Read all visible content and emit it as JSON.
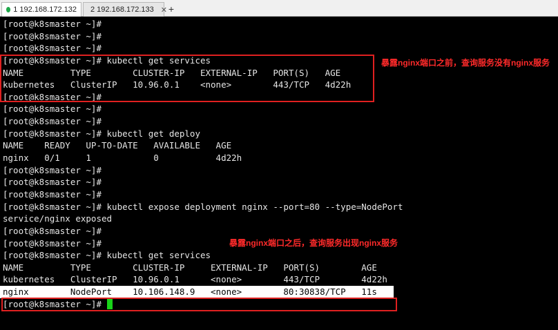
{
  "tabs": [
    {
      "label": "1 192.168.172.132",
      "active": true,
      "dot_color": "#1fa84a"
    },
    {
      "label": "2 192.168.172.133",
      "active": false,
      "dot_color": "#1fa84a"
    }
  ],
  "tab_add_label": "+",
  "terminal": {
    "lines": [
      "[root@k8smaster ~]#",
      "[root@k8smaster ~]#",
      "[root@k8smaster ~]#",
      "[root@k8smaster ~]# kubectl get services",
      "NAME         TYPE        CLUSTER-IP   EXTERNAL-IP   PORT(S)   AGE",
      "kubernetes   ClusterIP   10.96.0.1    <none>        443/TCP   4d22h",
      "[root@k8smaster ~]#",
      "[root@k8smaster ~]#",
      "[root@k8smaster ~]#",
      "[root@k8smaster ~]# kubectl get deploy",
      "NAME    READY   UP-TO-DATE   AVAILABLE   AGE",
      "nginx   0/1     1            0           4d22h",
      "[root@k8smaster ~]#",
      "[root@k8smaster ~]#",
      "[root@k8smaster ~]#",
      "[root@k8smaster ~]# kubectl expose deployment nginx --port=80 --type=NodePort",
      "service/nginx exposed",
      "[root@k8smaster ~]#",
      "[root@k8smaster ~]#",
      "[root@k8smaster ~]# kubectl get services",
      "NAME         TYPE        CLUSTER-IP     EXTERNAL-IP   PORT(S)        AGE",
      "kubernetes   ClusterIP   10.96.0.1      <none>        443/TCP        4d22h",
      "nginx        NodePort    10.106.148.9   <none>        80:30838/TCP   11s",
      "[root@k8smaster ~]# "
    ],
    "cursor_color": "#19d419"
  },
  "annotations": {
    "before": "暴露nginx端口之前，查询服务没有nginx服务",
    "after": "暴露nginx端口之后，查询服务出现nginx服务"
  },
  "colors": {
    "terminal_bg": "#000000",
    "terminal_fg": "#e6e6e6",
    "annotation_red": "#e02020"
  }
}
